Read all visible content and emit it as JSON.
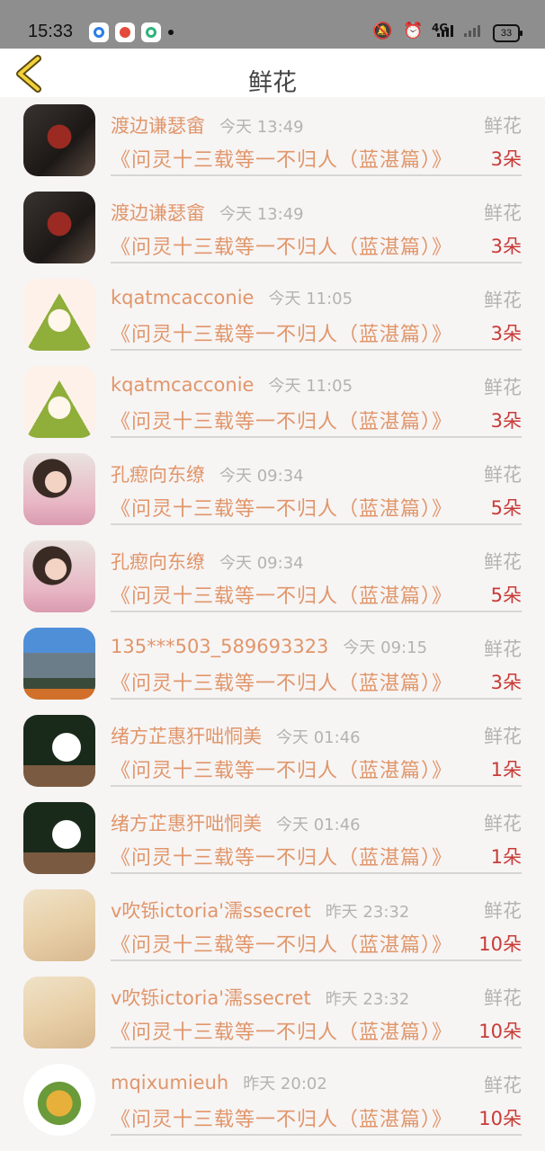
{
  "status_bar": {
    "time": "15:33",
    "network": "4G",
    "battery": "33"
  },
  "header": {
    "title": "鲜花",
    "back_icon": "chevron-left-icon"
  },
  "rows": [
    {
      "name": "渡边谦瑟畲",
      "time": "今天 13:49",
      "gift": "鲜花",
      "book": "《问灵十三载等一不归人（蓝湛篇）》",
      "count": "3朵"
    },
    {
      "name": "渡边谦瑟畲",
      "time": "今天 13:49",
      "gift": "鲜花",
      "book": "《问灵十三载等一不归人（蓝湛篇）》",
      "count": "3朵"
    },
    {
      "name": "kqatmcacconie",
      "time": "今天 11:05",
      "gift": "鲜花",
      "book": "《问灵十三载等一不归人（蓝湛篇）》",
      "count": "3朵"
    },
    {
      "name": "kqatmcacconie",
      "time": "今天 11:05",
      "gift": "鲜花",
      "book": "《问灵十三载等一不归人（蓝湛篇）》",
      "count": "3朵"
    },
    {
      "name": "孔瘛向东缭",
      "time": "今天 09:34",
      "gift": "鲜花",
      "book": "《问灵十三载等一不归人（蓝湛篇）》",
      "count": "5朵"
    },
    {
      "name": "孔瘛向东缭",
      "time": "今天 09:34",
      "gift": "鲜花",
      "book": "《问灵十三载等一不归人（蓝湛篇）》",
      "count": "5朵"
    },
    {
      "name": "135***503_589693323",
      "time": "今天 09:15",
      "gift": "鲜花",
      "book": "《问灵十三载等一不归人（蓝湛篇）》",
      "count": "3朵"
    },
    {
      "name": "绪方芷惠犴咄恫美",
      "time": "今天 01:46",
      "gift": "鲜花",
      "book": "《问灵十三载等一不归人（蓝湛篇）》",
      "count": "1朵"
    },
    {
      "name": "绪方芷惠犴咄恫美",
      "time": "今天 01:46",
      "gift": "鲜花",
      "book": "《问灵十三载等一不归人（蓝湛篇）》",
      "count": "1朵"
    },
    {
      "name": "v吹铄ictoria'濡ssecret",
      "time": "昨天 23:32",
      "gift": "鲜花",
      "book": "《问灵十三载等一不归人（蓝湛篇）》",
      "count": "10朵"
    },
    {
      "name": "v吹铄ictoria'濡ssecret",
      "time": "昨天 23:32",
      "gift": "鲜花",
      "book": "《问灵十三载等一不归人（蓝湛篇）》",
      "count": "10朵"
    },
    {
      "name": "mqixumieuh",
      "time": "昨天 20:02",
      "gift": "鲜花",
      "book": "《问灵十三载等一不归人（蓝湛篇）》",
      "count": "10朵"
    }
  ]
}
